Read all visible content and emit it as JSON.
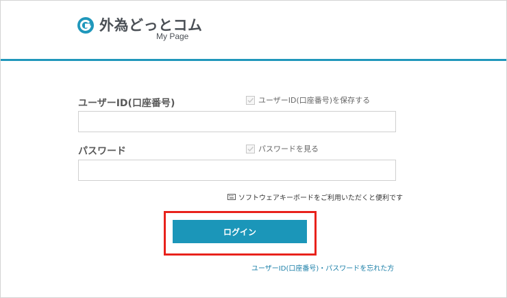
{
  "header": {
    "logo_title": "外為どっとコム",
    "logo_subtitle": "My Page",
    "accent_color": "#1f97bb"
  },
  "form": {
    "user_id_label": "ユーザーID(口座番号)",
    "save_user_id_label": "ユーザーID(口座番号)を保存する",
    "user_id_value": "",
    "password_label": "パスワード",
    "show_password_label": "パスワードを見る",
    "password_value": "",
    "software_keyboard_text": "ソフトウェアキーボードをご利用いただくと便利です",
    "login_button_label": "ログイン",
    "forgot_link_text": "ユーザーID(口座番号)・パスワードを忘れた方"
  },
  "icons": {
    "logo": "g-logo-icon",
    "checkbox_mark": "check-icon",
    "keyboard": "keyboard-icon"
  },
  "colors": {
    "button": "#1b96b9",
    "highlight": "#e8211b",
    "link": "#1b7fa8"
  }
}
